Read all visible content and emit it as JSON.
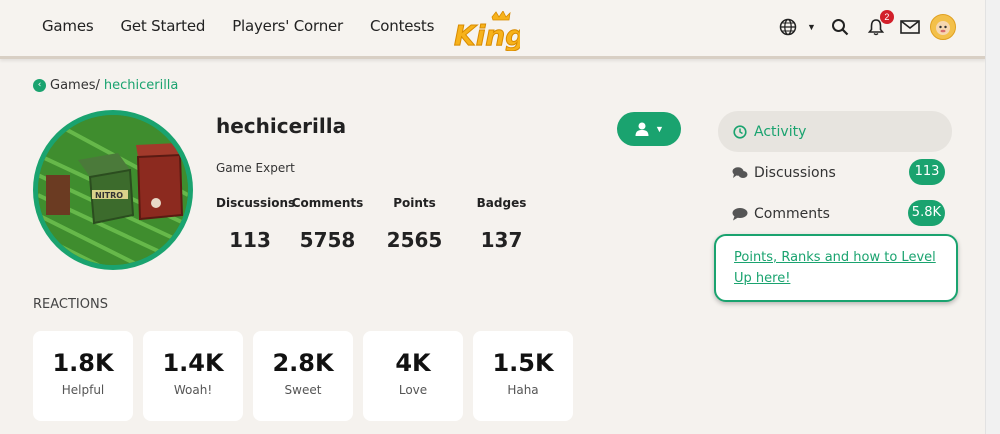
{
  "nav": {
    "items": [
      "Games",
      "Get Started",
      "Players' Corner",
      "Contests"
    ]
  },
  "logo": {
    "text": "King"
  },
  "header": {
    "notifications_count": "2",
    "icons": [
      "globe-icon",
      "search-icon",
      "bell-icon",
      "mail-icon",
      "avatar"
    ]
  },
  "breadcrumb": {
    "parent": "Games/",
    "current": "hechicerilla"
  },
  "profile": {
    "username": "hechicerilla",
    "role": "Game Expert",
    "stats": [
      {
        "label": "Discussions",
        "value": "113"
      },
      {
        "label": "Comments",
        "value": "5758"
      },
      {
        "label": "Points",
        "value": "2565"
      },
      {
        "label": "Badges",
        "value": "137"
      }
    ]
  },
  "reactions": {
    "title": "REACTIONS",
    "items": [
      {
        "count": "1.8K",
        "label": "Helpful"
      },
      {
        "count": "1.4K",
        "label": "Woah!"
      },
      {
        "count": "2.8K",
        "label": "Sweet"
      },
      {
        "count": "4K",
        "label": "Love"
      },
      {
        "count": "1.5K",
        "label": "Haha"
      }
    ]
  },
  "sidebar": {
    "items": [
      {
        "label": "Activity",
        "count": ""
      },
      {
        "label": "Discussions",
        "count": "113"
      },
      {
        "label": "Comments",
        "count": "5.8K"
      }
    ],
    "levelup_link": "Points, Ranks and how to Level Up here!"
  },
  "colors": {
    "accent": "#1aa36f",
    "background": "#f5f2ee",
    "badge_red": "#d21f2a"
  }
}
